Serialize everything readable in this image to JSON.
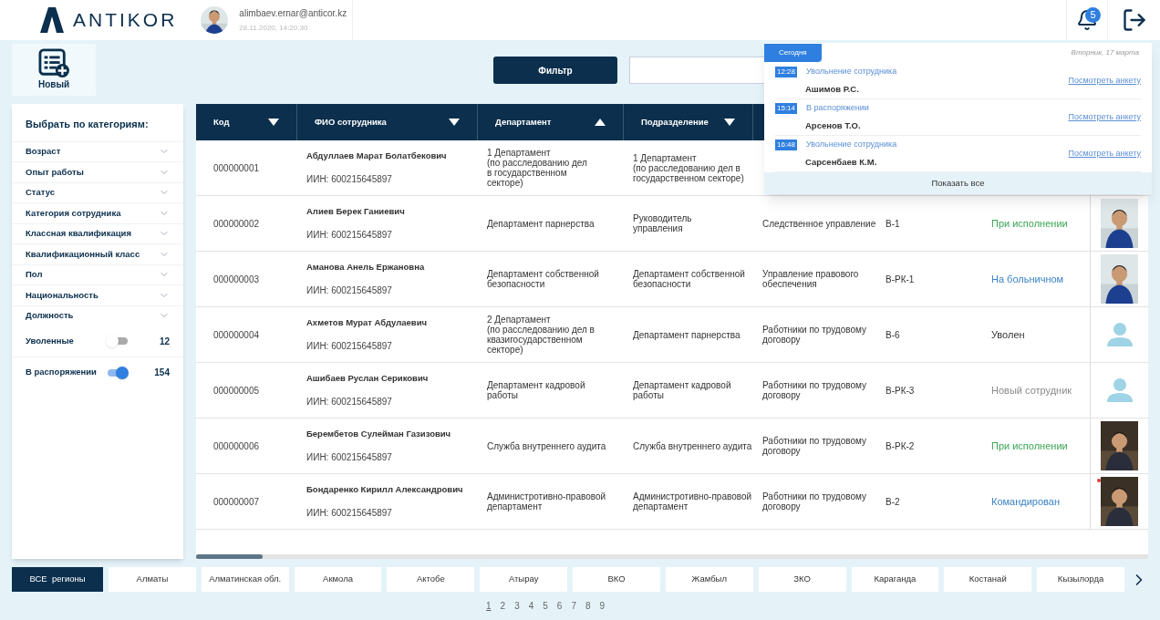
{
  "header": {
    "logo": "ANTIKOR",
    "user": {
      "email": "alimbaev.ernar@anticor.kz",
      "datetime": "28.11.2020, 14:20:30"
    },
    "notifications_count": "5"
  },
  "toolbar": {
    "new_label": "Новый",
    "filter_label": "Фильтр"
  },
  "categories": {
    "title": "Выбрать по категориям:",
    "items": [
      {
        "label": "Возраст",
        "expanded": false
      },
      {
        "label": "Опыт работы",
        "expanded": false
      },
      {
        "label": "Статус",
        "expanded": false
      },
      {
        "label": "Категория сотрудника",
        "expanded": false
      },
      {
        "label": "Классная квалификация",
        "expanded": false
      },
      {
        "label": "Квалификационный класс",
        "expanded": false
      },
      {
        "label": "Пол",
        "expanded": false
      },
      {
        "label": "Национальность",
        "expanded": false
      },
      {
        "label": "Должность",
        "expanded": false
      }
    ],
    "toggles": [
      {
        "label": "Уволенные",
        "on": false,
        "count": "12"
      },
      {
        "label": "В распоряжении",
        "on": true,
        "count": "154"
      }
    ]
  },
  "table": {
    "columns": [
      {
        "label": "Код",
        "ascending": false
      },
      {
        "label": "ФИО сотрудника",
        "ascending": false
      },
      {
        "label": "Департамент",
        "ascending": true
      },
      {
        "label": "Подразделение",
        "ascending": false
      }
    ],
    "rows": [
      {
        "code": "000000001",
        "name": "Абдуллаев Марат Болатбекович",
        "iin": "ИИН: 600215645897",
        "department": "1 Департамент\n(по расследованию дел\nв государственном\nсекторе)",
        "division": "1 Департамент\n(по расследованию дел в\nгосударственном секторе)"
      },
      {
        "code": "000000002",
        "name": "Алиев Берек Ганиевич",
        "iin": "ИИН: 600215645897",
        "department": "Департамент парнерства",
        "division": "Руководитель\nуправления",
        "column_5": "Следственное управление",
        "column_6": "В-1",
        "status": "При исполнении",
        "color": "#3aa655",
        "flagged": false
      },
      {
        "code": "000000003",
        "name": "Аманова Анель Ержановна",
        "iin": "ИИН: 600215645897",
        "department": "Департамент собственной\nбезопасности",
        "division": "Департамент собственной\nбезопасности",
        "column_5": "Управление правового\nобеспечения",
        "column_6": "В-РК-1",
        "status": "На больничном",
        "color": "#3b82c4",
        "flagged": false
      },
      {
        "code": "000000004",
        "name": "Ахметов Мурат Абдулаевич",
        "iin": "ИИН: 600215645897",
        "department": "2 Департамент\n(по расследованию дел в\nквазигосударственном\nсекторе)",
        "division": "Департамент парнерства",
        "column_5": "Работники по трудовому\nдоговору",
        "column_6": "В-6",
        "status": "Уволен",
        "color": "#333333",
        "kind": "placeholder",
        "flagged": false
      },
      {
        "code": "000000005",
        "name": "Ашибаев Руслан Серикович",
        "iin": "ИИН: 600215645897",
        "department": "Департамент кадровой\nработы",
        "division": "Департамент кадровой\nработы",
        "column_5": "Работники по трудовому\nдоговору",
        "column_6": "В-РК-3",
        "status": "Новый сотрудник",
        "color": "#8a8a8a",
        "kind": "placeholder",
        "flagged": false
      },
      {
        "code": "000000006",
        "name": "Берембетов Сулейман Газизович",
        "iin": "ИИН: 600215645897",
        "department": "Служба внутреннего аудита",
        "division": "Служба внутреннего аудита",
        "column_5": "Работники по трудовому\nдоговору",
        "column_6": "В-РК-2",
        "status": "При исполнении",
        "color": "#3aa655",
        "flagged": false
      },
      {
        "code": "000000007",
        "name": "Бондаренко Кирилл Александрович",
        "iin": "ИИН: 600215645897",
        "department": "Администротивно-правовой\nдепартамент",
        "division": "Администротивно-правовой\nдепартамент",
        "column_5": "Работники по трудовому\nдоговору",
        "column_6": "В-2",
        "status": "Командирован",
        "color": "#3b82c4",
        "flagged": true
      }
    ]
  },
  "notifications": {
    "tab": "Сегодня",
    "date": "Вторник, 17 марта",
    "items": [
      {
        "time": "12:28",
        "event": "Увольнение сотрудника",
        "name": "Ашимов Р.С.",
        "link": "Посмотреть анкету"
      },
      {
        "time": "15:14",
        "event": "В распоряжении",
        "name": "Арсенов Т.О.",
        "link": "Посмотреть анкету"
      },
      {
        "time": "16:48",
        "event": "Увольнение сотрудника",
        "name": "Сарсенбаев К.М.",
        "link": "Посмотреть анкету"
      }
    ],
    "show_all": "Показать все"
  },
  "regions": [
    {
      "label": "ВСЕ  регионы",
      "selected": true
    },
    {
      "label": "Алматы",
      "selected": false
    },
    {
      "label": "Алматинская обл.",
      "selected": false
    },
    {
      "label": "Акмола",
      "selected": false
    },
    {
      "label": "Актобе",
      "selected": false
    },
    {
      "label": "Атырау",
      "selected": false
    },
    {
      "label": "ВКО",
      "selected": false
    },
    {
      "label": "Жамбыл",
      "selected": false
    },
    {
      "label": "ЗКО",
      "selected": false
    },
    {
      "label": "Караганда",
      "selected": false
    },
    {
      "label": "Костанай",
      "selected": false
    },
    {
      "label": "Кызылорда",
      "selected": false
    }
  ],
  "pagination": [
    {
      "label": "1",
      "selected": true
    },
    {
      "label": "2",
      "selected": false
    },
    {
      "label": "3",
      "selected": false
    },
    {
      "label": "4",
      "selected": false
    },
    {
      "label": "5",
      "selected": false
    },
    {
      "label": "6",
      "selected": false
    },
    {
      "label": "7",
      "selected": false
    },
    {
      "label": "8",
      "selected": false
    },
    {
      "label": "9",
      "selected": false
    }
  ]
}
